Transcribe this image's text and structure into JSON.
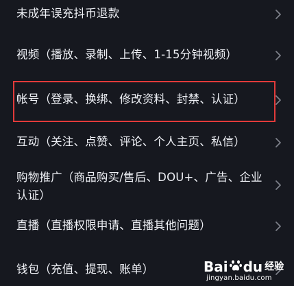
{
  "menu": {
    "items": [
      {
        "label": "未成年误充抖币退款"
      },
      {
        "label": "视频（播放、录制、上传、1-15分钟视频）"
      },
      {
        "label": "帐号（登录、换绑、修改资料、封禁、认证）"
      },
      {
        "label": "互动（关注、点赞、评论、个人主页、私信）"
      },
      {
        "label": "购物推广（商品购买/售后、DOU+、广告、企业认证）"
      },
      {
        "label": "直播（直播权限申请、直播其他问题）"
      },
      {
        "label": "钱包（充值、提现、账单）"
      }
    ],
    "chevron_icon": "chevron-right-icon"
  },
  "highlight": {
    "color": "#e23a3a"
  },
  "watermark": {
    "bai": "Bai",
    "du": "du",
    "jingyan": "经验",
    "url": "jingyan.baidu.com"
  },
  "colors": {
    "background": "#16181f",
    "text": "#eef0f5",
    "chevron": "#7d8089"
  }
}
